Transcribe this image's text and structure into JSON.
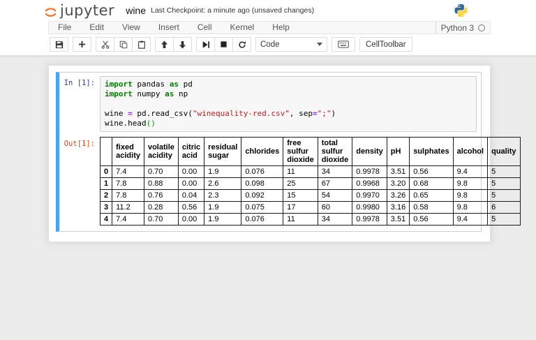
{
  "header": {
    "logo_text": "jupyter",
    "notebook_name": "wine",
    "checkpoint_text": "Last Checkpoint: a minute ago (unsaved changes)",
    "kernel_name": "Python 3"
  },
  "menu": {
    "items": [
      "File",
      "Edit",
      "View",
      "Insert",
      "Cell",
      "Kernel",
      "Help"
    ]
  },
  "toolbar": {
    "cell_type_selected": "Code",
    "celltoolbar_label": "CellToolbar",
    "icons": [
      "save-icon",
      "add-cell-icon",
      "cut-icon",
      "copy-icon",
      "paste-icon",
      "move-up-icon",
      "move-down-icon",
      "run-icon",
      "stop-icon",
      "restart-kernel-icon",
      "command-palette-keyboard-icon",
      "dropdown-caret-icon",
      "kernel-idle-circle-icon",
      "jupyter-logo-icon",
      "python-logo-icon"
    ]
  },
  "cell": {
    "in_prompt": "In [1]:",
    "out_prompt": "Out[1]:",
    "code_lines": [
      [
        {
          "t": "kw",
          "v": "import"
        },
        {
          "t": "tx",
          "v": " pandas "
        },
        {
          "t": "kw",
          "v": "as"
        },
        {
          "t": "tx",
          "v": " pd"
        }
      ],
      [
        {
          "t": "kw",
          "v": "import"
        },
        {
          "t": "tx",
          "v": " numpy "
        },
        {
          "t": "kw",
          "v": "as"
        },
        {
          "t": "tx",
          "v": " np"
        }
      ],
      [],
      [
        {
          "t": "tx",
          "v": "wine "
        },
        {
          "t": "op",
          "v": "="
        },
        {
          "t": "tx",
          "v": " pd.read_csv("
        },
        {
          "t": "str",
          "v": "\"winequality-red.csv\""
        },
        {
          "t": "tx",
          "v": ", sep"
        },
        {
          "t": "op",
          "v": "="
        },
        {
          "t": "str",
          "v": "\";\""
        },
        {
          "t": "tx",
          "v": ")"
        }
      ],
      [
        {
          "t": "tx",
          "v": "wine.head"
        },
        {
          "t": "mb",
          "v": "()"
        }
      ]
    ]
  },
  "table": {
    "columns": [
      "fixed acidity",
      "volatile acidity",
      "citric acid",
      "residual sugar",
      "chlorides",
      "free sulfur dioxide",
      "total sulfur dioxide",
      "density",
      "pH",
      "sulphates",
      "alcohol",
      "quality"
    ],
    "index": [
      "0",
      "1",
      "2",
      "3",
      "4"
    ],
    "rows": [
      [
        "7.4",
        "0.70",
        "0.00",
        "1.9",
        "0.076",
        "11",
        "34",
        "0.9978",
        "3.51",
        "0.56",
        "9.4",
        "5"
      ],
      [
        "7.8",
        "0.88",
        "0.00",
        "2.6",
        "0.098",
        "25",
        "67",
        "0.9968",
        "3.20",
        "0.68",
        "9.8",
        "5"
      ],
      [
        "7.8",
        "0.76",
        "0.04",
        "2.3",
        "0.092",
        "15",
        "54",
        "0.9970",
        "3.26",
        "0.65",
        "9.8",
        "5"
      ],
      [
        "11.2",
        "0.28",
        "0.56",
        "1.9",
        "0.075",
        "17",
        "60",
        "0.9980",
        "3.16",
        "0.58",
        "9.8",
        "6"
      ],
      [
        "7.4",
        "0.70",
        "0.00",
        "1.9",
        "0.076",
        "11",
        "34",
        "0.9978",
        "3.51",
        "0.56",
        "9.4",
        "5"
      ]
    ]
  },
  "colors": {
    "jupyter_orange": "#F37726",
    "selected_cell_blue": "#42A5F5",
    "in_prompt_navy": "#303F9F",
    "out_prompt_red": "#D84315",
    "keyword_green": "#008000",
    "string_red": "#BA2121",
    "operator_purple": "#AA22FF",
    "page_background": "#ececec",
    "python_blue": "#366994",
    "python_yellow": "#FFD43B"
  }
}
